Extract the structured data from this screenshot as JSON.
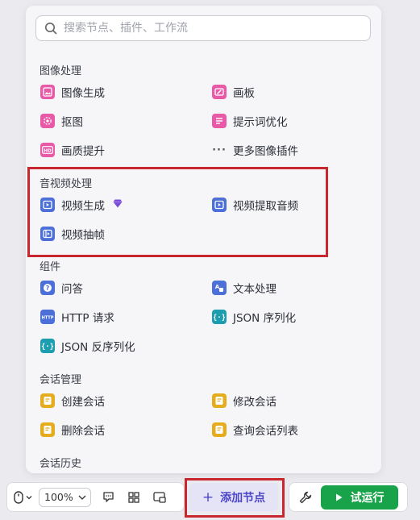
{
  "search": {
    "placeholder": "搜索节点、插件、工作流"
  },
  "sections": {
    "image": {
      "title": "图像处理",
      "items": [
        "图像生成",
        "画板",
        "抠图",
        "提示词优化",
        "画质提升",
        "更多图像插件"
      ]
    },
    "audio_video": {
      "title": "音视频处理",
      "items": [
        "视频生成",
        "视频提取音频",
        "视频抽帧"
      ]
    },
    "components": {
      "title": "组件",
      "items": [
        "问答",
        "文本处理",
        "HTTP 请求",
        "JSON 序列化",
        "JSON 反序列化"
      ]
    },
    "conversation": {
      "title": "会话管理",
      "items": [
        "创建会话",
        "修改会话",
        "删除会话",
        "查询会话列表"
      ]
    },
    "history": {
      "title": "会话历史"
    }
  },
  "icons": {
    "image_generate": "image-icon",
    "canvas": "canvas-icon",
    "matting": "matting-icon",
    "prompt_optimize": "list-icon",
    "hd_upscale": "hd-icon",
    "more": "ellipsis-icon",
    "video_generate": "video-play-icon",
    "premium": "diamond-icon",
    "video_audio": "video-play-icon",
    "video_frames": "film-frame-icon",
    "qa": "question-icon",
    "text_process": "text-process-icon",
    "http": "http-icon",
    "json_serialize": "braces-icon",
    "json_deserialize": "braces-icon",
    "conversation": "chat-doc-icon"
  },
  "toolbar": {
    "zoom": "100%",
    "add_node": "添加节点",
    "run": "试运行"
  },
  "colors": {
    "pink": "#e85aa8",
    "blue": "#4c6fd8",
    "teal": "#1c9eb0",
    "yellow": "#e5ac1e",
    "purple_accent": "#4b45c9",
    "run_green": "#18a34a",
    "highlight_red": "#c8272f"
  }
}
